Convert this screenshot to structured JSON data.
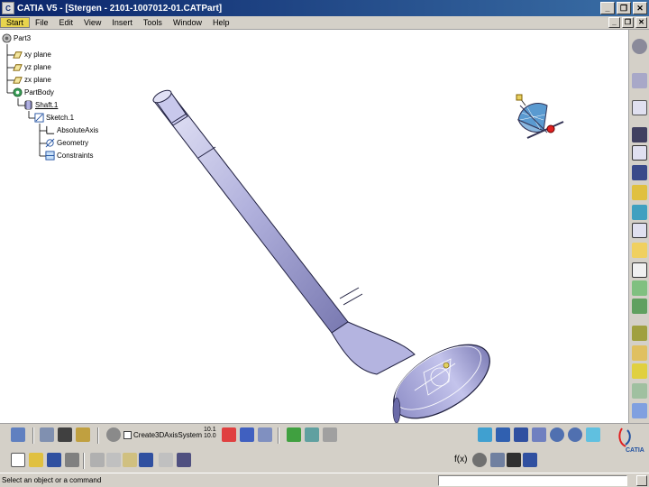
{
  "window": {
    "title": "CATIA V5 - [Stergen - 2101-1007012-01.CATPart]",
    "app_icon": "catia-app-icon",
    "controls": [
      "_",
      "❐",
      "✕"
    ]
  },
  "menubar": {
    "items": [
      "Start",
      "File",
      "Edit",
      "View",
      "Insert",
      "Tools",
      "Window",
      "Help"
    ]
  },
  "tree": {
    "root": "Part3",
    "items": [
      {
        "label": "xy plane",
        "icon": "plane-icon"
      },
      {
        "label": "yz plane",
        "icon": "plane-icon"
      },
      {
        "label": "zx plane",
        "icon": "plane-icon"
      },
      {
        "label": "PartBody",
        "icon": "partbody-icon"
      },
      {
        "label": "Shaft.1",
        "icon": "shaft-icon"
      },
      {
        "label": "Sketch.1",
        "icon": "sketch-icon"
      },
      {
        "label": "AbsoluteAxis",
        "icon": "axis-icon"
      },
      {
        "label": "Geometry",
        "icon": "geometry-icon"
      },
      {
        "label": "Constraints",
        "icon": "constraints-icon"
      }
    ]
  },
  "bottom_toolbar": {
    "create_axis_label": "Create3DAxisSystem",
    "value_top": "10.1",
    "value_bottom": "10.0"
  },
  "statusbar": {
    "prompt": "Select an object or a command",
    "command_value": ""
  },
  "brand": {
    "logo_text": "CATIA"
  },
  "colors": {
    "titlebar": "#0a246a",
    "chrome": "#d4d0c8",
    "part": "#a8a8d8",
    "start_menu": "#e8d44d"
  }
}
